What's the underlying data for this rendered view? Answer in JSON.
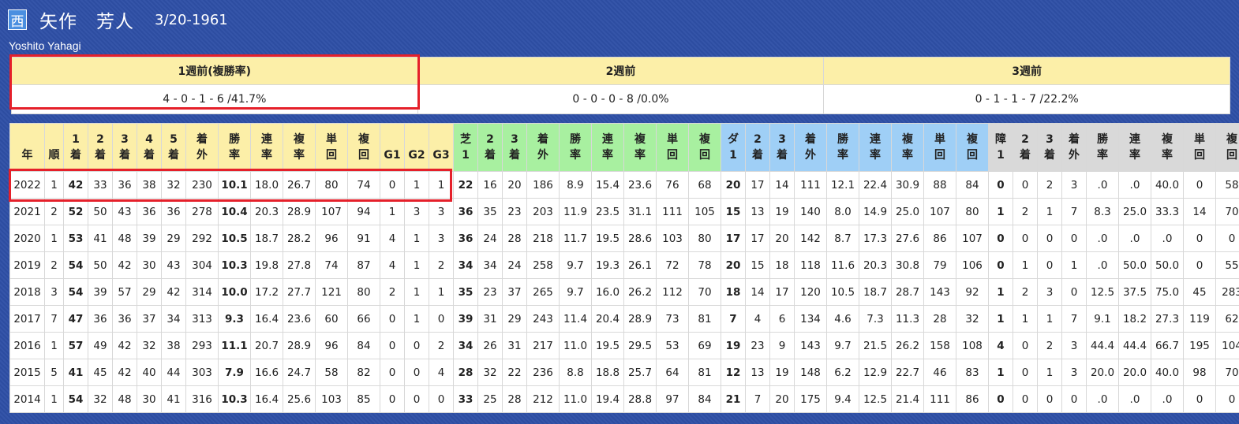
{
  "profile": {
    "region_badge": "西",
    "name": "矢作　芳人",
    "birthdate": "3/20-1961",
    "romanized": "Yoshito Yahagi"
  },
  "weeks": [
    {
      "label": "1週前(複勝率)",
      "value": "4 - 0 - 1 - 6 /41.7%"
    },
    {
      "label": "2週前",
      "value": "0 - 0 - 0 - 8 /0.0%"
    },
    {
      "label": "3週前",
      "value": "0 - 1 - 1 - 7 /22.2%"
    }
  ],
  "colors": {
    "background": "#2e4fa6",
    "header_yellow": "#fcefa8",
    "turf_green": "#a8f0a0",
    "dirt_blue": "#9fcff6",
    "obstacle_gray": "#d9d9d9",
    "highlight_red": "#e5202a"
  },
  "table": {
    "headers": [
      {
        "top": "",
        "bottom": "年",
        "group": "y"
      },
      {
        "top": "",
        "bottom": "順",
        "group": "y"
      },
      {
        "top": "1",
        "bottom": "着",
        "group": "y"
      },
      {
        "top": "2",
        "bottom": "着",
        "group": "y"
      },
      {
        "top": "3",
        "bottom": "着",
        "group": "y"
      },
      {
        "top": "4",
        "bottom": "着",
        "group": "y"
      },
      {
        "top": "5",
        "bottom": "着",
        "group": "y"
      },
      {
        "top": "着",
        "bottom": "外",
        "group": "y"
      },
      {
        "top": "勝",
        "bottom": "率",
        "group": "y"
      },
      {
        "top": "連",
        "bottom": "率",
        "group": "y"
      },
      {
        "top": "複",
        "bottom": "率",
        "group": "y"
      },
      {
        "top": "単",
        "bottom": "回",
        "group": "y"
      },
      {
        "top": "複",
        "bottom": "回",
        "group": "y"
      },
      {
        "top": "",
        "bottom": "G1",
        "group": "y"
      },
      {
        "top": "",
        "bottom": "G2",
        "group": "y"
      },
      {
        "top": "",
        "bottom": "G3",
        "group": "y"
      },
      {
        "top": "芝",
        "bottom": "1",
        "group": "t"
      },
      {
        "top": "2",
        "bottom": "着",
        "group": "t"
      },
      {
        "top": "3",
        "bottom": "着",
        "group": "t"
      },
      {
        "top": "着",
        "bottom": "外",
        "group": "t"
      },
      {
        "top": "勝",
        "bottom": "率",
        "group": "t"
      },
      {
        "top": "連",
        "bottom": "率",
        "group": "t"
      },
      {
        "top": "複",
        "bottom": "率",
        "group": "t"
      },
      {
        "top": "単",
        "bottom": "回",
        "group": "t"
      },
      {
        "top": "複",
        "bottom": "回",
        "group": "t"
      },
      {
        "top": "ダ",
        "bottom": "1",
        "group": "d"
      },
      {
        "top": "2",
        "bottom": "着",
        "group": "d"
      },
      {
        "top": "3",
        "bottom": "着",
        "group": "d"
      },
      {
        "top": "着",
        "bottom": "外",
        "group": "d"
      },
      {
        "top": "勝",
        "bottom": "率",
        "group": "d"
      },
      {
        "top": "連",
        "bottom": "率",
        "group": "d"
      },
      {
        "top": "複",
        "bottom": "率",
        "group": "d"
      },
      {
        "top": "単",
        "bottom": "回",
        "group": "d"
      },
      {
        "top": "複",
        "bottom": "回",
        "group": "d"
      },
      {
        "top": "障",
        "bottom": "1",
        "group": "o"
      },
      {
        "top": "2",
        "bottom": "着",
        "group": "o"
      },
      {
        "top": "3",
        "bottom": "着",
        "group": "o"
      },
      {
        "top": "着",
        "bottom": "外",
        "group": "o"
      },
      {
        "top": "勝",
        "bottom": "率",
        "group": "o"
      },
      {
        "top": "連",
        "bottom": "率",
        "group": "o"
      },
      {
        "top": "複",
        "bottom": "率",
        "group": "o"
      },
      {
        "top": "単",
        "bottom": "回",
        "group": "o"
      },
      {
        "top": "複",
        "bottom": "回",
        "group": "o"
      }
    ],
    "rows": [
      [
        "2022",
        "1",
        "42",
        "33",
        "36",
        "38",
        "32",
        "230",
        "10.1",
        "18.0",
        "26.7",
        "80",
        "74",
        "0",
        "1",
        "1",
        "22",
        "16",
        "20",
        "186",
        "8.9",
        "15.4",
        "23.6",
        "76",
        "68",
        "20",
        "17",
        "14",
        "111",
        "12.1",
        "22.4",
        "30.9",
        "88",
        "84",
        "0",
        "0",
        "2",
        "3",
        ".0",
        ".0",
        "40.0",
        "0",
        "58"
      ],
      [
        "2021",
        "2",
        "52",
        "50",
        "43",
        "36",
        "36",
        "278",
        "10.4",
        "20.3",
        "28.9",
        "107",
        "94",
        "1",
        "3",
        "3",
        "36",
        "35",
        "23",
        "203",
        "11.9",
        "23.5",
        "31.1",
        "111",
        "105",
        "15",
        "13",
        "19",
        "140",
        "8.0",
        "14.9",
        "25.0",
        "107",
        "80",
        "1",
        "2",
        "1",
        "7",
        "8.3",
        "25.0",
        "33.3",
        "14",
        "70"
      ],
      [
        "2020",
        "1",
        "53",
        "41",
        "48",
        "39",
        "29",
        "292",
        "10.5",
        "18.7",
        "28.2",
        "96",
        "91",
        "4",
        "1",
        "3",
        "36",
        "24",
        "28",
        "218",
        "11.7",
        "19.5",
        "28.6",
        "103",
        "80",
        "17",
        "17",
        "20",
        "142",
        "8.7",
        "17.3",
        "27.6",
        "86",
        "107",
        "0",
        "0",
        "0",
        "0",
        ".0",
        ".0",
        ".0",
        "0",
        "0"
      ],
      [
        "2019",
        "2",
        "54",
        "50",
        "42",
        "30",
        "43",
        "304",
        "10.3",
        "19.8",
        "27.8",
        "74",
        "87",
        "4",
        "1",
        "2",
        "34",
        "34",
        "24",
        "258",
        "9.7",
        "19.3",
        "26.1",
        "72",
        "78",
        "20",
        "15",
        "18",
        "118",
        "11.6",
        "20.3",
        "30.8",
        "79",
        "106",
        "0",
        "1",
        "0",
        "1",
        ".0",
        "50.0",
        "50.0",
        "0",
        "55"
      ],
      [
        "2018",
        "3",
        "54",
        "39",
        "57",
        "29",
        "42",
        "314",
        "10.0",
        "17.2",
        "27.7",
        "121",
        "80",
        "2",
        "1",
        "1",
        "35",
        "23",
        "37",
        "265",
        "9.7",
        "16.0",
        "26.2",
        "112",
        "70",
        "18",
        "14",
        "17",
        "120",
        "10.5",
        "18.7",
        "28.7",
        "143",
        "92",
        "1",
        "2",
        "3",
        "0",
        "12.5",
        "37.5",
        "75.0",
        "45",
        "283"
      ],
      [
        "2017",
        "7",
        "47",
        "36",
        "36",
        "37",
        "34",
        "313",
        "9.3",
        "16.4",
        "23.6",
        "60",
        "66",
        "0",
        "1",
        "0",
        "39",
        "31",
        "29",
        "243",
        "11.4",
        "20.4",
        "28.9",
        "73",
        "81",
        "7",
        "4",
        "6",
        "134",
        "4.6",
        "7.3",
        "11.3",
        "28",
        "32",
        "1",
        "1",
        "1",
        "7",
        "9.1",
        "18.2",
        "27.3",
        "119",
        "62"
      ],
      [
        "2016",
        "1",
        "57",
        "49",
        "42",
        "32",
        "38",
        "293",
        "11.1",
        "20.7",
        "28.9",
        "96",
        "84",
        "0",
        "0",
        "2",
        "34",
        "26",
        "31",
        "217",
        "11.0",
        "19.5",
        "29.5",
        "53",
        "69",
        "19",
        "23",
        "9",
        "143",
        "9.7",
        "21.5",
        "26.2",
        "158",
        "108",
        "4",
        "0",
        "2",
        "3",
        "44.4",
        "44.4",
        "66.7",
        "195",
        "104"
      ],
      [
        "2015",
        "5",
        "41",
        "45",
        "42",
        "40",
        "44",
        "303",
        "7.9",
        "16.6",
        "24.7",
        "58",
        "82",
        "0",
        "0",
        "4",
        "28",
        "32",
        "22",
        "236",
        "8.8",
        "18.8",
        "25.7",
        "64",
        "81",
        "12",
        "13",
        "19",
        "148",
        "6.2",
        "12.9",
        "22.7",
        "46",
        "83",
        "1",
        "0",
        "1",
        "3",
        "20.0",
        "20.0",
        "40.0",
        "98",
        "70"
      ],
      [
        "2014",
        "1",
        "54",
        "32",
        "48",
        "30",
        "41",
        "316",
        "10.3",
        "16.4",
        "25.6",
        "103",
        "85",
        "0",
        "0",
        "0",
        "33",
        "25",
        "28",
        "212",
        "11.0",
        "19.4",
        "28.8",
        "97",
        "84",
        "21",
        "7",
        "20",
        "175",
        "9.4",
        "12.5",
        "21.4",
        "111",
        "86",
        "0",
        "0",
        "0",
        "0",
        ".0",
        ".0",
        ".0",
        "0",
        "0"
      ]
    ]
  }
}
